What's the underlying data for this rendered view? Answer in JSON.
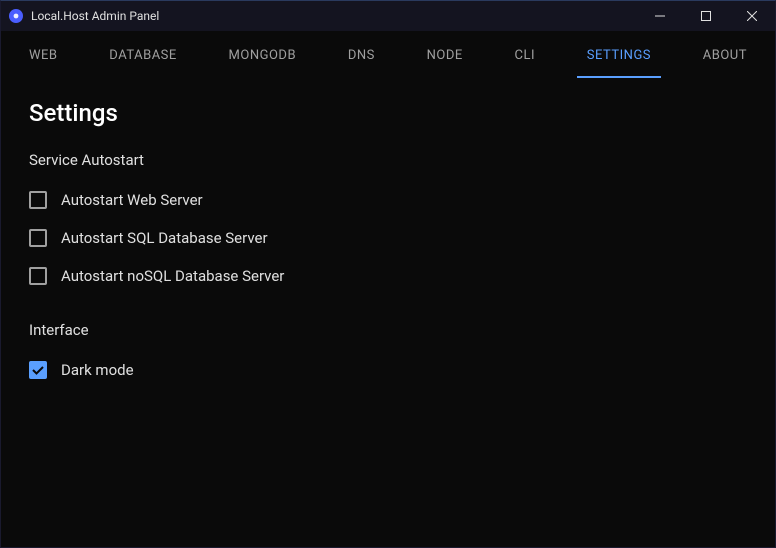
{
  "window": {
    "title": "Local.Host Admin Panel"
  },
  "tabs": [
    {
      "label": "WEB",
      "active": false
    },
    {
      "label": "DATABASE",
      "active": false
    },
    {
      "label": "MONGODB",
      "active": false
    },
    {
      "label": "DNS",
      "active": false
    },
    {
      "label": "NODE",
      "active": false
    },
    {
      "label": "CLI",
      "active": false
    },
    {
      "label": "SETTINGS",
      "active": true
    },
    {
      "label": "ABOUT",
      "active": false
    }
  ],
  "page": {
    "title": "Settings",
    "sections": [
      {
        "title": "Service Autostart",
        "options": [
          {
            "label": "Autostart Web Server",
            "checked": false
          },
          {
            "label": "Autostart SQL Database Server",
            "checked": false
          },
          {
            "label": "Autostart noSQL Database Server",
            "checked": false
          }
        ]
      },
      {
        "title": "Interface",
        "options": [
          {
            "label": "Dark mode",
            "checked": true
          }
        ]
      }
    ]
  }
}
